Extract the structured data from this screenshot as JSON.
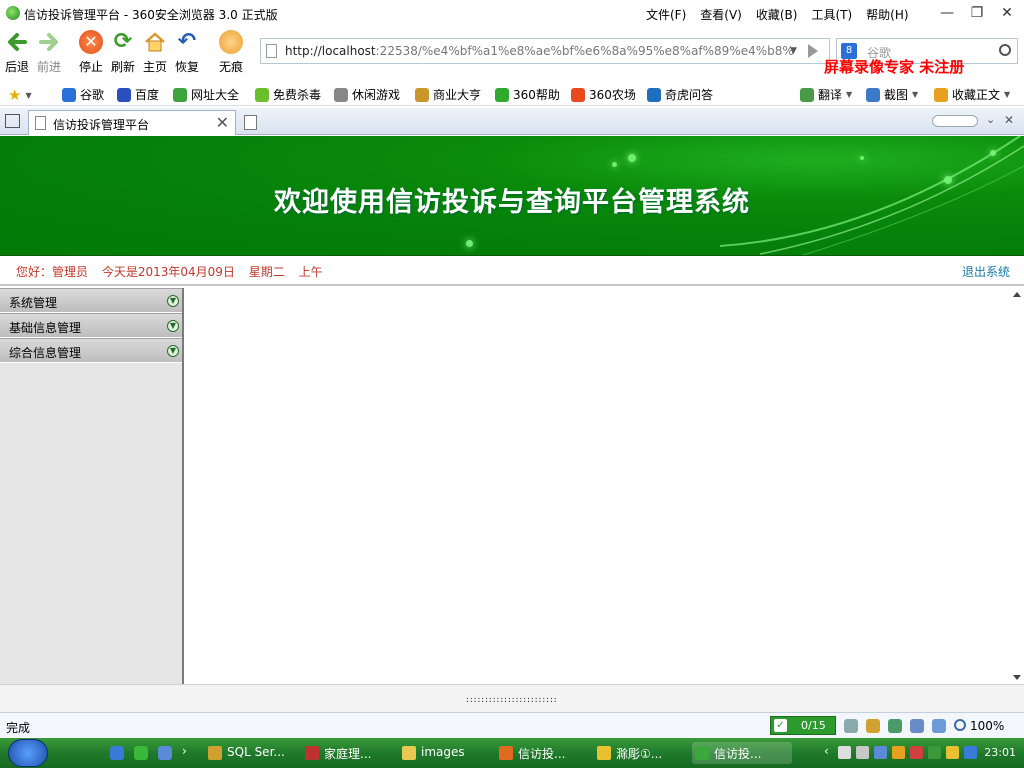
{
  "window": {
    "title": "信访投诉管理平台 - 360安全浏览器 3.0 正式版",
    "menu": [
      "文件(F)",
      "查看(V)",
      "收藏(B)",
      "工具(T)",
      "帮助(H)"
    ]
  },
  "toolbar": {
    "back": "后退",
    "forward": "前进",
    "stop": "停止",
    "refresh": "刷新",
    "home": "主页",
    "restore": "恢复",
    "incognito": "无痕",
    "address_host": "http://localhost",
    "address_rest": ":22538/%e4%bf%a1%e8%ae%bf%e6%8a%95%e8%af%89%e4%b8%",
    "search_placeholder": "谷歌",
    "watermark": "屏幕录像专家  未注册"
  },
  "favorites": [
    {
      "label": "谷歌",
      "color": "#2b6fd8"
    },
    {
      "label": "百度",
      "color": "#2b4fbf"
    },
    {
      "label": "网址大全",
      "color": "#3da33d"
    },
    {
      "label": "免费杀毒",
      "color": "#6bbf2f"
    },
    {
      "label": "休闲游戏",
      "color": "#888888"
    },
    {
      "label": "商业大亨",
      "color": "#c8962a"
    },
    {
      "label": "360帮助",
      "color": "#2faa2f"
    },
    {
      "label": "360农场",
      "color": "#e8491d"
    },
    {
      "label": "奇虎问答",
      "color": "#1f6fbf"
    }
  ],
  "fav_right": {
    "translate": "翻译",
    "screenshot": "截图",
    "collect": "收藏正文"
  },
  "tab": {
    "title": "信访投诉管理平台"
  },
  "banner": {
    "heading": "欢迎使用信访投诉与查询平台管理系统"
  },
  "welcome": {
    "greeting": "您好：管理员",
    "date": "今天是2013年04月09日",
    "weekday": "星期二",
    "ampm": "上午",
    "logout": "退出系统"
  },
  "sidebar": {
    "items": [
      {
        "label": "系统管理"
      },
      {
        "label": "基础信息管理"
      },
      {
        "label": "综合信息管理"
      }
    ]
  },
  "splitter": {
    "grip": "::::::::::::::::::::::::"
  },
  "status": {
    "text": "完成",
    "counter": "0/15",
    "zoom": "100%"
  },
  "taskbar": {
    "items": [
      {
        "label": "SQL Ser...",
        "color": "#d0a030"
      },
      {
        "label": "家庭理...",
        "color": "#c03030"
      },
      {
        "label": "images",
        "color": "#e8c850"
      },
      {
        "label": "信访投...",
        "color": "#e06a20"
      },
      {
        "label": "滁彫①...",
        "color": "#e8c030"
      },
      {
        "label": "信访投...",
        "color": "#3aa83a"
      }
    ],
    "clock": "23:01"
  }
}
